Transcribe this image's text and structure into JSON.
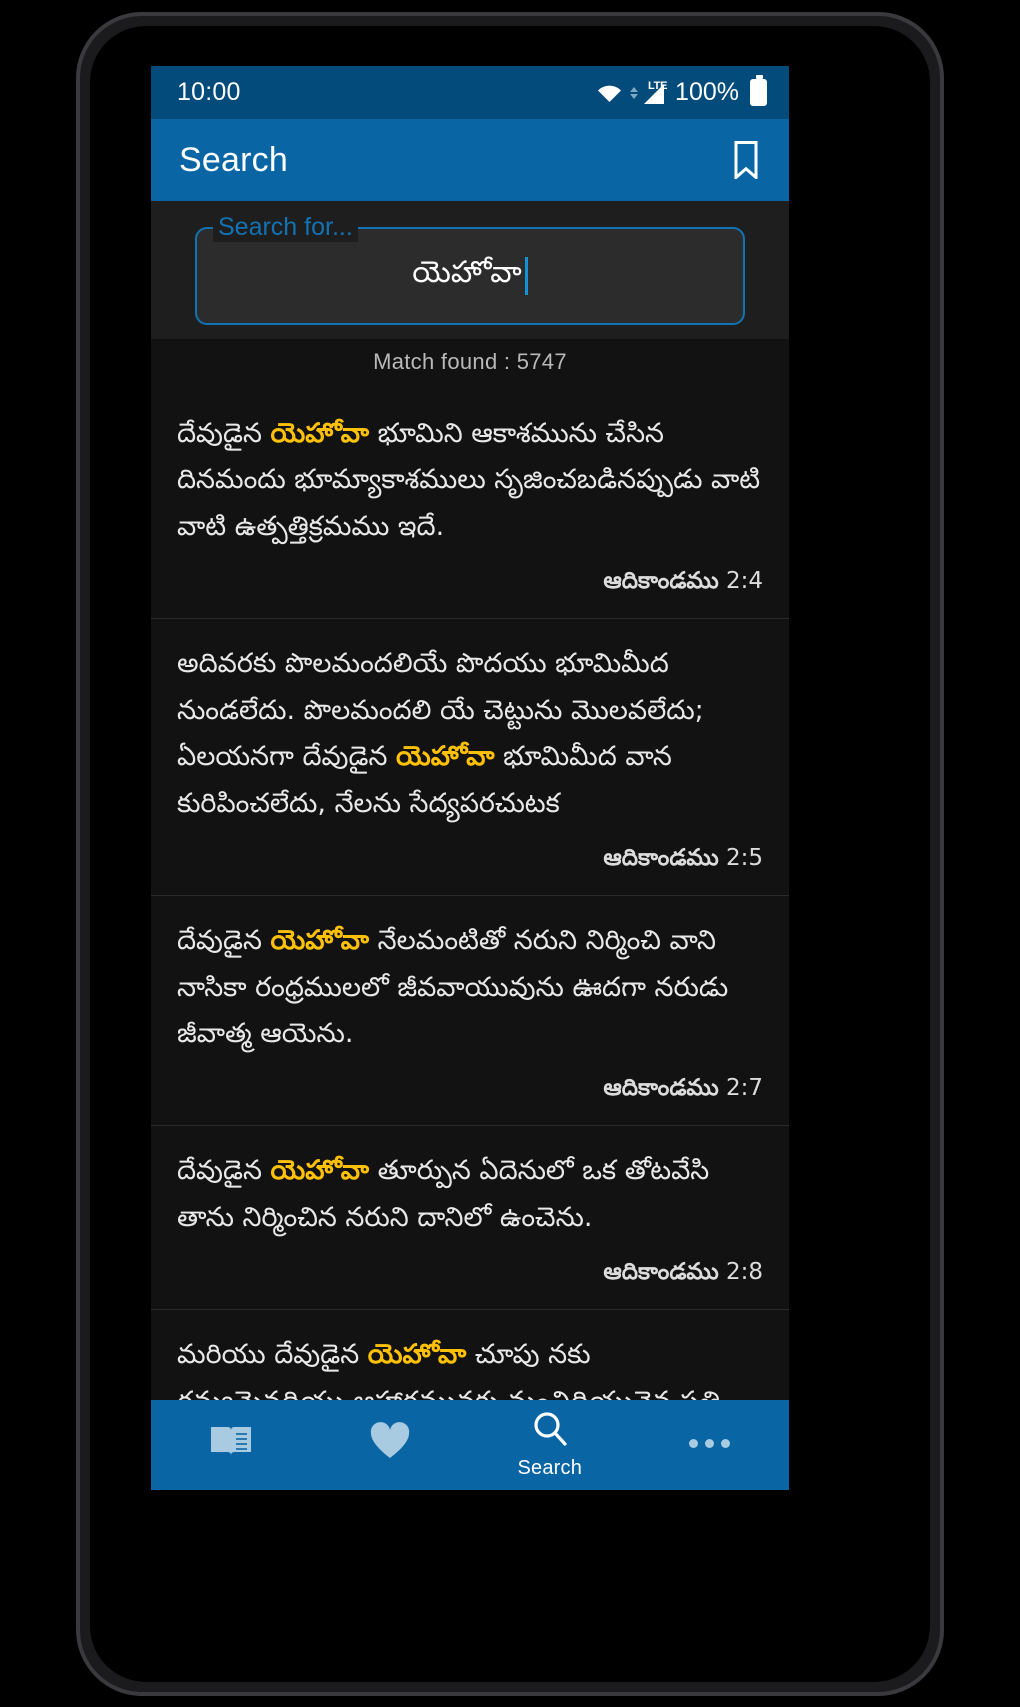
{
  "status_bar": {
    "clock": "10:00",
    "network_type": "LTE",
    "battery_percent": "100%",
    "icons": [
      "wifi-icon",
      "lte-signal-icon",
      "battery-icon"
    ]
  },
  "app_bar": {
    "title": "Search",
    "bookmark_icon": "bookmark-icon"
  },
  "search": {
    "label": "Search for...",
    "value": "యెహోవా",
    "placeholder": "Search for...",
    "accent_color": "#1273b4"
  },
  "match": {
    "text": "Match found : 5747",
    "count": 5747
  },
  "results": [
    {
      "pre": "దేవుడైన ",
      "highlight": "యెహోవా",
      "post": " భూమిని ఆకాశమును చేసిన దినమందు భూమ్యాకాశములు సృజించబడినప్పుడు వాటి వాటి ఉత్పత్తిక్రమము ఇదే.",
      "book": "ఆదికాండము",
      "chapter_verse": "2:4"
    },
    {
      "pre": "అదివరకు పొలమందలియే పొదయు భూమిమీద నుండలేదు. పొలమందలి యే చెట్టును మొలవలేదు; ఏలయనగా దేవుడైన ",
      "highlight": "యెహోవా",
      "post": " భూమిమీద వాన కురిపించలేదు, నేలను సేద్యపరచుటక",
      "book": "ఆదికాండము",
      "chapter_verse": "2:5"
    },
    {
      "pre": "దేవుడైన ",
      "highlight": "యెహోవా",
      "post": " నేలమంటితో నరుని నిర్మించి వాని నాసికా రంధ్రములలో జీవవాయువును ఊదగా నరుడు జీవాత్మ ఆయెను.",
      "book": "ఆదికాండము",
      "chapter_verse": "2:7"
    },
    {
      "pre": "దేవుడైన ",
      "highlight": "యెహోవా",
      "post": " తూర్పున ఏదెనులో ఒక తోటవేసి తాను నిర్మించిన నరుని దానిలో ఉంచెను.",
      "book": "ఆదికాండము",
      "chapter_verse": "2:8"
    },
    {
      "pre": "మరియు దేవుడైన ",
      "highlight": "యెహోవా",
      "post": " చూపు నకు రమ్యమైనదియు ఆహారమునకు మంచిదియునైన ప్రతి వృక్షమును, ఆ తోటమధ్యను జీవవృక్షమును, మంచి చెడ్డల తెలివినిచ్చు వృక్షమును నేలనుండి మొలిపించెను.",
      "book": "",
      "chapter_verse": ""
    }
  ],
  "bottom_nav": [
    {
      "icon": "book-icon",
      "label": "",
      "active": false
    },
    {
      "icon": "heart-icon",
      "label": "",
      "active": false
    },
    {
      "icon": "search-icon",
      "label": "Search",
      "active": true
    },
    {
      "icon": "more-icon",
      "label": "",
      "active": false
    }
  ],
  "colors": {
    "app_bar": "#0a65a5",
    "status_bar": "#034b7b",
    "background": "#121212",
    "highlight": "#ffc107",
    "accent": "#1273b4"
  }
}
